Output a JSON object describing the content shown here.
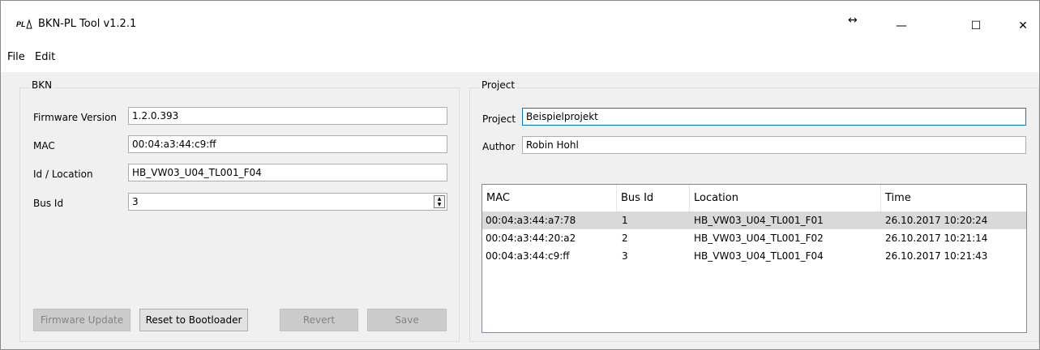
{
  "window": {
    "title": "BKN-PL Tool v1.2.1",
    "app_icon": "PL",
    "resize_glyph": "↔",
    "min_glyph": "—",
    "max_glyph": "☐",
    "close_glyph": "✕"
  },
  "menu": {
    "file": "File",
    "edit": "Edit"
  },
  "bkn": {
    "title": "BKN",
    "firmware_label": "Firmware Version",
    "firmware_value": "1.2.0.393",
    "mac_label": "MAC",
    "mac_value": "00:04:a3:44:c9:ff",
    "location_label": "Id / Location",
    "location_value": "HB_VW03_U04_TL001_F04",
    "busid_label": "Bus Id",
    "busid_value": "3",
    "buttons": {
      "firmware_update": "Firmware Update",
      "reset": "Reset to Bootloader",
      "revert": "Revert",
      "save": "Save"
    }
  },
  "project": {
    "title": "Project",
    "project_label": "Project",
    "project_value": "Beispielprojekt",
    "author_label": "Author",
    "author_value": "Robin Hohl",
    "columns": [
      "MAC",
      "Bus Id",
      "Location",
      "Time"
    ],
    "rows": [
      [
        "00:04:a3:44:a7:78",
        "1",
        "HB_VW03_U04_TL001_F01",
        "26.10.2017 10:20:24"
      ],
      [
        "00:04:a3:44:20:a2",
        "2",
        "HB_VW03_U04_TL001_F02",
        "26.10.2017 10:21:14"
      ],
      [
        "00:04:a3:44:c9:ff",
        "3",
        "HB_VW03_U04_TL001_F04",
        "26.10.2017 10:21:43"
      ]
    ]
  }
}
